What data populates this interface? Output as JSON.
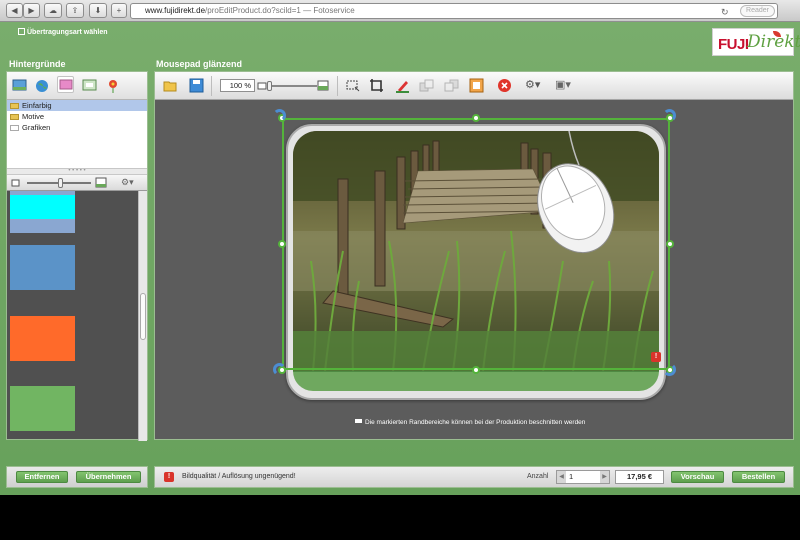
{
  "browser": {
    "url_host": "www.fujidirekt.de",
    "url_path": "/proEditProduct.do?scild=1",
    "url_suffix": " — Fotoservice",
    "reader_label": "Reader"
  },
  "header": {
    "back_link": "Übertragungsart wählen",
    "logo_fuji": "FUJI",
    "logo_direkt": "Direkt"
  },
  "left_panel": {
    "title": "Hintergründe",
    "categories": [
      {
        "label": "Einfarbig"
      },
      {
        "label": "Motive"
      },
      {
        "label": "Grafiken"
      }
    ],
    "swatches": [
      {
        "color": "#00ffff"
      },
      {
        "color": "#5b93c8"
      },
      {
        "color": "#ff6a2a"
      },
      {
        "color": "#71b562"
      },
      {
        "color": "#ffffff"
      }
    ],
    "remove_button": "Entfernen",
    "apply_button": "Übernehmen"
  },
  "main_panel": {
    "title": "Mousepad glänzend",
    "zoom_value": "100 %",
    "hint_text": "Die markierten Randbereiche können bei der Produktion beschnitten werden",
    "warning_text": "Bildqualität / Auflösung ungenügend!",
    "quantity_label": "Anzahl",
    "quantity_value": "1",
    "price": "17,95 €",
    "preview_button": "Vorschau",
    "order_button": "Bestellen"
  },
  "icons": [
    "back-icon",
    "forward-icon",
    "cloud-icon",
    "share-icon",
    "download-icon",
    "add-tab-icon",
    "folder-open-icon",
    "save-icon",
    "zoom-out-icon",
    "zoom-in-icon",
    "fit-icon",
    "crop-icon",
    "text-icon",
    "layer-back-icon",
    "layer-front-icon",
    "frame-icon",
    "delete-icon",
    "settings-icon",
    "grid-icon"
  ]
}
